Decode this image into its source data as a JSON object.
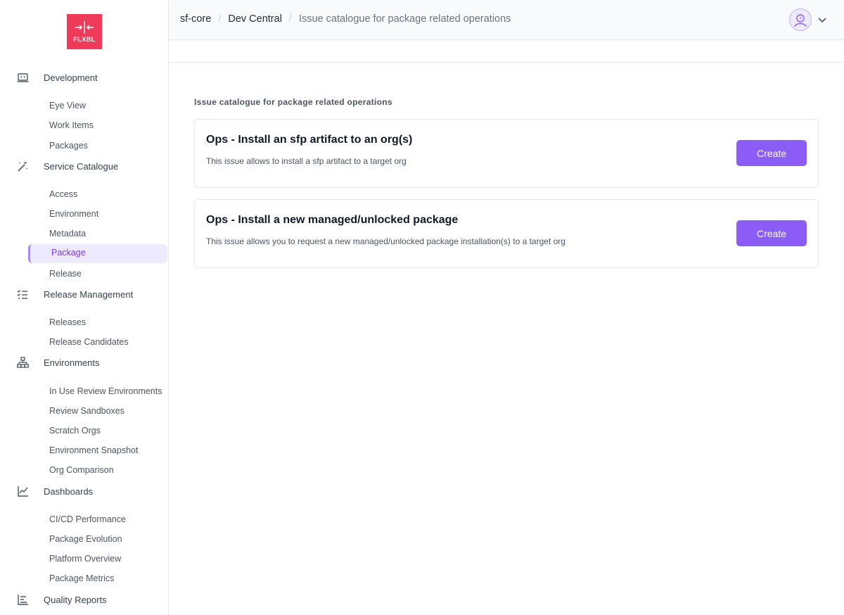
{
  "logo": {
    "text": "FLXBL"
  },
  "sidebar": {
    "sections": [
      {
        "label": "Development",
        "icon": "laptop-code-icon"
      },
      {
        "label": "Service Catalogue",
        "icon": "magic-wand-icon"
      },
      {
        "label": "Release Management",
        "icon": "checklist-icon"
      },
      {
        "label": "Environments",
        "icon": "network-icon"
      },
      {
        "label": "Dashboards",
        "icon": "line-chart-icon"
      },
      {
        "label": "Quality Reports",
        "icon": "bar-chart-icon"
      }
    ],
    "development_items": [
      "Eye View",
      "Work Items",
      "Packages"
    ],
    "service_catalogue_items": [
      "Access",
      "Environment",
      "Metadata",
      "Package",
      "Release"
    ],
    "release_management_items": [
      "Releases",
      "Release Candidates"
    ],
    "environments_items": [
      "In Use Review Environments",
      "Review Sandboxes",
      "Scratch Orgs",
      "Environment Snapshot",
      "Org Comparison"
    ],
    "dashboards_items": [
      "CI/CD Performance",
      "Package Evolution",
      "Platform Overview",
      "Package Metrics"
    ],
    "active_item": "Package"
  },
  "header": {
    "breadcrumbs": [
      "sf-core",
      "Dev Central",
      "Issue catalogue for package related operations"
    ]
  },
  "content": {
    "title": "Issue catalogue for package related operations",
    "cards": [
      {
        "title": "Ops - Install an sfp artifact to an org(s)",
        "description": "This issue allows to install a sfp artifact to a target org",
        "button": "Create"
      },
      {
        "title": "Ops - Install a new managed/unlocked package",
        "description": "This issue allows you to request a new managed/unlocked package installation(s) to a target org",
        "button": "Create"
      }
    ]
  },
  "colors": {
    "brand": "#ef3b5a",
    "accent": "#8b5cf6",
    "active_bg": "#ede9fe"
  }
}
